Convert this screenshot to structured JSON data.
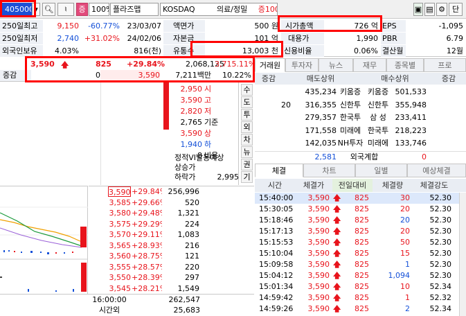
{
  "toolbar": {
    "code": "405000",
    "zoom": "100%",
    "theme_label": "플라즈맵",
    "market": "KOSDAQ",
    "sector": "의료/정밀",
    "margin": "증100",
    "extra": "단",
    "badge": "증"
  },
  "info": {
    "row1": {
      "l1": "250일최고",
      "v1": "9,150",
      "p1": "-60.77%",
      "d1": "23/03/07",
      "l2": "액면가",
      "v2": "500 원",
      "l3": "시가총액",
      "v3": "726 억",
      "l4": "EPS",
      "v4": "-1,095"
    },
    "row2": {
      "l1": "250일최저",
      "v1": "2,740",
      "p1": "+31.02%",
      "d1": "24/02/06",
      "l2": "자본금",
      "v2": "101 억",
      "l3": "대용가",
      "v3": "1,990",
      "l4": "PBR",
      "v4": "6.79"
    },
    "row3": {
      "l1": "외국인보유",
      "v1": "4.03%",
      "d1": "816(천)",
      "l2": "유통수",
      "v2": "13,003 천",
      "l3": "신용비율",
      "v3": "0.06%",
      "l4": "결산월",
      "v4": "12월"
    }
  },
  "quote": {
    "price": "3,590",
    "change": "825",
    "rate": "+29.84%",
    "volume": "2,068,125",
    "vol_rate": "3,715.11%",
    "label2": "증감",
    "v2a": "0",
    "v2b": "3,590",
    "v2c": "7,211백만",
    "v2d": "10.22%"
  },
  "levels": [
    {
      "v": "2,950",
      "l": "시",
      "cls": "red"
    },
    {
      "v": "3,590",
      "l": "고",
      "cls": "red"
    },
    {
      "v": "2,820",
      "l": "저",
      "cls": "red"
    },
    {
      "v": "2,765",
      "l": "기준",
      "cls": ""
    },
    {
      "v": "3,590",
      "l": "상",
      "cls": "red"
    },
    {
      "v": "1,940",
      "l": "하",
      "cls": "blue"
    },
    {
      "v": "8",
      "l": "비용",
      "cls": ""
    }
  ],
  "vi": {
    "title": "정적VI발동예상",
    "up": "상승가",
    "down": "하락가",
    "down_v": "2,995"
  },
  "side_tabs": [
    "수",
    "도",
    "투",
    "외",
    "차",
    "뉴",
    "권",
    "기"
  ],
  "orderbook": [
    {
      "p": "3,590",
      "r": "+29.84%",
      "q": "256,996"
    },
    {
      "p": "3,585",
      "r": "+29.66%",
      "q": "520"
    },
    {
      "p": "3,580",
      "r": "+29.48%",
      "q": "1,321"
    },
    {
      "p": "3,575",
      "r": "+29.29%",
      "q": "224"
    },
    {
      "p": "3,570",
      "r": "+29.11%",
      "q": "1,083"
    },
    {
      "p": "3,565",
      "r": "+28.93%",
      "q": "216"
    },
    {
      "p": "3,560",
      "r": "+28.75%",
      "q": "121"
    },
    {
      "p": "3,555",
      "r": "+28.57%",
      "q": "220"
    },
    {
      "p": "3,550",
      "r": "+28.39%",
      "q": "297"
    },
    {
      "p": "3,545",
      "r": "+28.21%",
      "q": "1,549"
    }
  ],
  "bottom": {
    "time": "16:00:00",
    "total": "262,547",
    "after_label": "시간외",
    "after_v": "25,683"
  },
  "tabs_top": [
    "거래원",
    "투자자",
    "뉴스",
    "재무",
    "종목별",
    "프로"
  ],
  "broker": {
    "h": [
      "증감",
      "매도상위",
      "매수상위",
      "증감"
    ],
    "rows": [
      {
        "d": "",
        "sv": "435,234",
        "sn": "키움증",
        "bn": "키움증",
        "bv": "501,533"
      },
      {
        "d": "20",
        "sv": "316,355",
        "sn": "신한투",
        "bn": "신한투",
        "bv": "355,948"
      },
      {
        "d": "",
        "sv": "279,357",
        "sn": "한국투",
        "bn": "삼 성",
        "bv": "233,411"
      },
      {
        "d": "",
        "sv": "171,558",
        "sn": "미래에",
        "bn": "한국투",
        "bv": "218,223"
      },
      {
        "d": "",
        "sv": "142,035",
        "sn": "NH투자",
        "bn": "미래에",
        "bv": "133,746"
      }
    ],
    "foreign_v": "2,581",
    "foreign_l": "외국계합",
    "foreign_b": "0"
  },
  "tabs_mid": [
    "체결",
    "차트",
    "일별",
    "예상체결"
  ],
  "trades": {
    "h": [
      "시간",
      "체결가",
      "전일대비",
      "체결량",
      "체결강도"
    ],
    "rows": [
      {
        "t": "15:40:00",
        "p": "3,590",
        "c": "825",
        "q": "30",
        "s": "52.30",
        "qc": "red"
      },
      {
        "t": "15:30:05",
        "p": "3,590",
        "c": "825",
        "q": "20",
        "s": "52.30",
        "qc": "red"
      },
      {
        "t": "15:18:46",
        "p": "3,590",
        "c": "825",
        "q": "20",
        "s": "52.30",
        "qc": "blue"
      },
      {
        "t": "15:17:13",
        "p": "3,590",
        "c": "825",
        "q": "20",
        "s": "52.30",
        "qc": "red"
      },
      {
        "t": "15:15:53",
        "p": "3,590",
        "c": "825",
        "q": "50",
        "s": "52.30",
        "qc": "red"
      },
      {
        "t": "15:10:04",
        "p": "3,590",
        "c": "825",
        "q": "15",
        "s": "52.30",
        "qc": "red"
      },
      {
        "t": "15:09:58",
        "p": "3,590",
        "c": "825",
        "q": "1",
        "s": "52.30",
        "qc": "blue"
      },
      {
        "t": "15:04:12",
        "p": "3,590",
        "c": "825",
        "q": "1,094",
        "s": "52.30",
        "qc": "blue"
      },
      {
        "t": "15:01:34",
        "p": "3,590",
        "c": "825",
        "q": "10",
        "s": "52.34",
        "qc": "red"
      },
      {
        "t": "14:59:42",
        "p": "3,590",
        "c": "825",
        "q": "1",
        "s": "52.32",
        "qc": "red"
      },
      {
        "t": "14:59:26",
        "p": "3,590",
        "c": "825",
        "q": "2",
        "s": "52.34",
        "qc": "blue"
      }
    ]
  },
  "colors": {
    "up": "#e8141c",
    "down": "#1450d8",
    "highlight": "#ff0000"
  },
  "icons": [
    "search-icon",
    "speaker-icon",
    "chart-icon",
    "gear-icon",
    "layout-icon",
    "arrow-up-icon"
  ]
}
